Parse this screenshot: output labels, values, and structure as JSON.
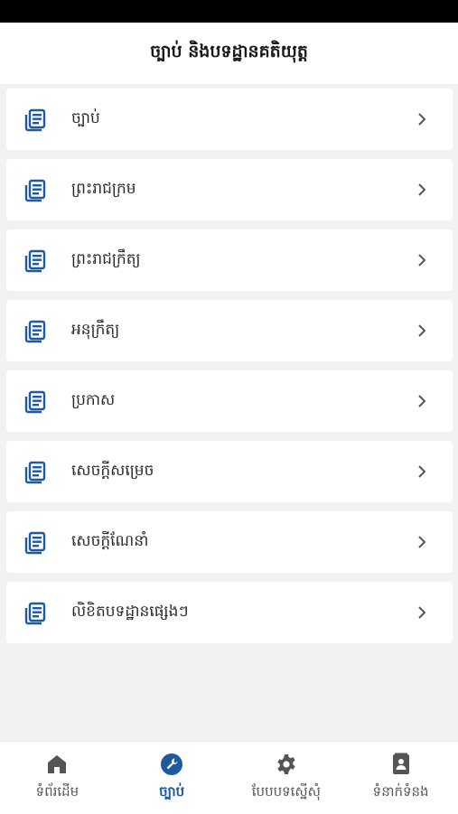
{
  "header": {
    "title": "ច្បាប់ និងបទដ្ឋានគតិយុត្ត"
  },
  "list": {
    "items": [
      {
        "label": "ច្បាប់"
      },
      {
        "label": "ព្រះរាជក្រម"
      },
      {
        "label": "ព្រះរាជក្រឹត្យ"
      },
      {
        "label": "អនុក្រឹត្យ"
      },
      {
        "label": "ប្រកាស"
      },
      {
        "label": "សេចក្តីសម្រេច"
      },
      {
        "label": "សេចក្តីណែនាំ"
      },
      {
        "label": "លិខិតបទដ្ឋានផ្សេងៗ"
      }
    ],
    "icon": "document-list-icon",
    "chevron": "chevron-right-icon"
  },
  "tabs": [
    {
      "label": "ទំព័រដើម",
      "icon": "home-icon",
      "active": false
    },
    {
      "label": "ច្បាប់",
      "icon": "wrench-icon",
      "active": true
    },
    {
      "label": "បែបបទស្នើសុំ",
      "icon": "gear-icon",
      "active": false
    },
    {
      "label": "ទំនាក់ទំនង",
      "icon": "contact-card-icon",
      "active": false
    }
  ],
  "colors": {
    "accent": "#1e5aa0",
    "icon_gray": "#555555",
    "background": "#f2f2f4"
  }
}
